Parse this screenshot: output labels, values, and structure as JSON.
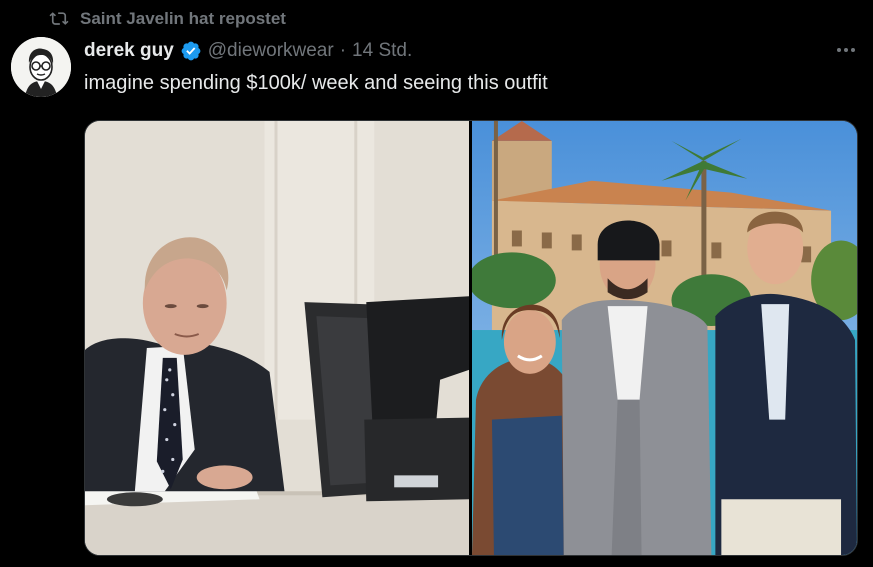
{
  "repost": {
    "label": "Saint Javelin hat repostet",
    "icon": "repost-icon"
  },
  "author": {
    "display_name": "derek guy",
    "handle": "@dieworkwear",
    "separator": "·",
    "time": "14 Std.",
    "verified": true,
    "verified_color": "#1d9bf0"
  },
  "tweet": {
    "text": "imagine spending $100k/ week and seeing this outfit"
  },
  "media": {
    "count": 2
  },
  "colors": {
    "background": "#000000",
    "primary_text": "#e7e9ea",
    "secondary_text": "#71767b",
    "accent": "#1d9bf0"
  }
}
